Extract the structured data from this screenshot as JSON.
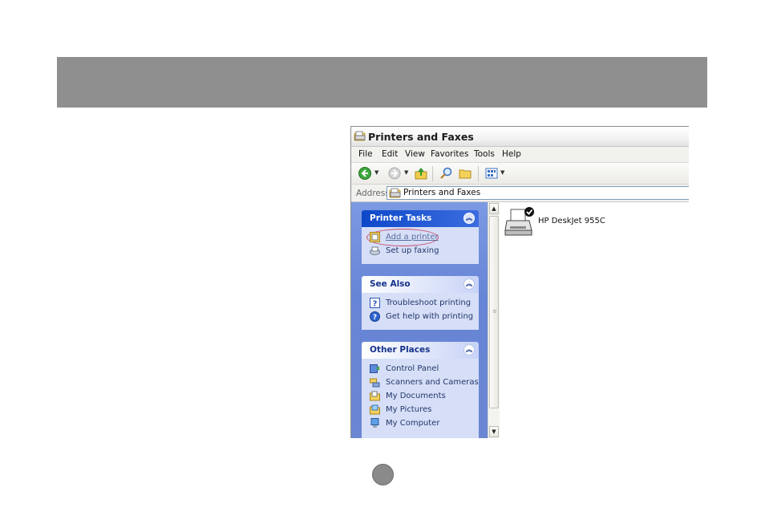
{
  "window": {
    "title": "Printers and Faxes"
  },
  "menu": {
    "file": "File",
    "edit": "Edit",
    "view": "View",
    "favorites": "Favorites",
    "tools": "Tools",
    "help": "Help"
  },
  "address": {
    "label": "Address",
    "value": "Printers and Faxes"
  },
  "panels": {
    "printer_tasks": {
      "title": "Printer Tasks",
      "items": [
        "Add a printer",
        "Set up faxing"
      ]
    },
    "see_also": {
      "title": "See Also",
      "items": [
        "Troubleshoot printing",
        "Get help with printing"
      ]
    },
    "other_places": {
      "title": "Other Places",
      "items": [
        "Control Panel",
        "Scanners and Cameras",
        "My Documents",
        "My Pictures",
        "My Computer"
      ]
    }
  },
  "printers": [
    {
      "name": "HP DeskJet 955C",
      "default": true
    }
  ],
  "colors": {
    "header_bar": "#8f8f8f",
    "taskpane": "#6b86d2",
    "highlight": "#c94b6a"
  },
  "icons": {
    "back": "green-back-arrow",
    "forward": "forward-arrow",
    "up": "folder-up",
    "search": "magnifier",
    "folders": "folder",
    "views": "views-grid"
  }
}
